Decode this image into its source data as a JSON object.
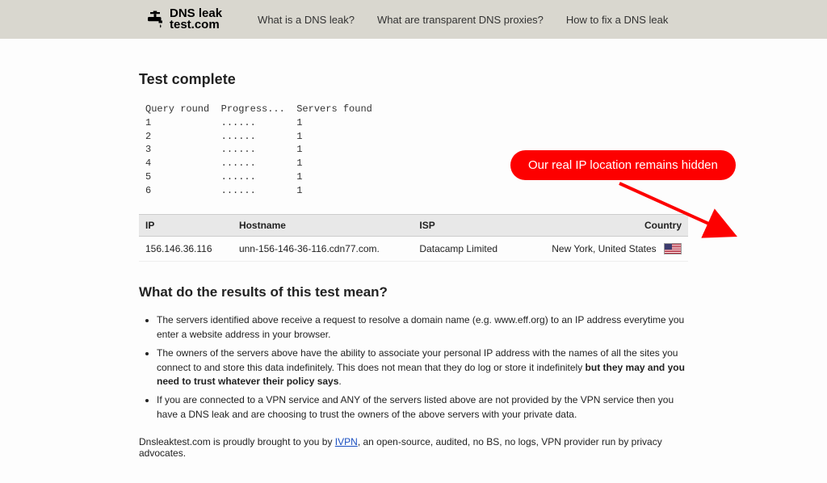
{
  "brand": {
    "line1": "DNS leak",
    "line2": "test.com"
  },
  "nav": {
    "what_is": "What is a DNS leak?",
    "proxies": "What are transparent DNS proxies?",
    "fix": "How to fix a DNS leak"
  },
  "page_title": "Test complete",
  "log": {
    "header": {
      "round": "Query round",
      "progress": "Progress...",
      "servers": "Servers found"
    },
    "rows": [
      {
        "round": "1",
        "progress": "......",
        "servers": "1"
      },
      {
        "round": "2",
        "progress": "......",
        "servers": "1"
      },
      {
        "round": "3",
        "progress": "......",
        "servers": "1"
      },
      {
        "round": "4",
        "progress": "......",
        "servers": "1"
      },
      {
        "round": "5",
        "progress": "......",
        "servers": "1"
      },
      {
        "round": "6",
        "progress": "......",
        "servers": "1"
      }
    ]
  },
  "table": {
    "headers": {
      "ip": "IP",
      "hostname": "Hostname",
      "isp": "ISP",
      "country": "Country"
    },
    "row": {
      "ip": "156.146.36.116",
      "hostname": "unn-156-146-36-116.cdn77.com.",
      "isp": "Datacamp Limited",
      "country": "New York, United States",
      "flag_name": "us-flag-icon"
    }
  },
  "explain": {
    "title": "What do the results of this test mean?",
    "b1": "The servers identified above receive a request to resolve a domain name (e.g. www.eff.org) to an IP address everytime you enter a website address in your browser.",
    "b2a": "The owners of the servers above have the ability to associate your personal IP address with the names of all the sites you connect to and store this data indefinitely. This does not mean that they do log or store it indefinitely ",
    "b2b": "but they may and you need to trust whatever their policy says",
    "b2c": ".",
    "b3": "If you are connected to a VPN service and ANY of the servers listed above are not provided by the VPN service then you have a DNS leak and are choosing to trust the owners of the above servers with your private data."
  },
  "footer": {
    "pre": "Dnsleaktest.com is proudly brought to you by ",
    "link": "IVPN",
    "post": ", an open-source, audited, no BS, no logs, VPN provider run by privacy advocates."
  },
  "callout": {
    "text": "Our real IP location remains hidden"
  }
}
